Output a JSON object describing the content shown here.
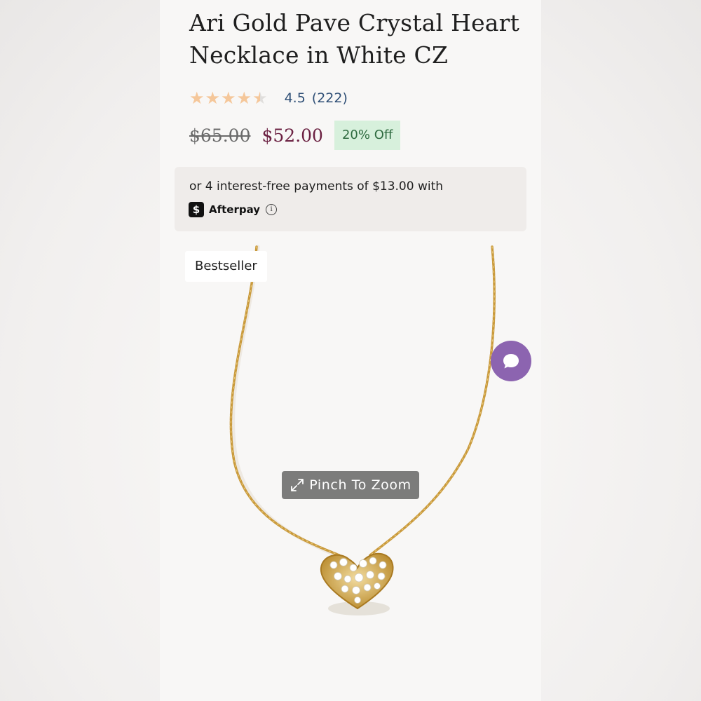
{
  "product": {
    "title": "Ari Gold Pave Crystal Heart Necklace in White CZ",
    "rating": {
      "value": "4.5",
      "count": "(222)",
      "stars_value": 4.5,
      "stars_max": 5
    },
    "price": {
      "original": "$65.00",
      "sale": "$52.00",
      "discount": "20% Off"
    },
    "afterpay": {
      "text": "or 4 interest-free payments of $13.00 with",
      "brand": "Afterpay",
      "logo_glyph": "$"
    },
    "image": {
      "badge": "Bestseller",
      "zoom_hint": "Pinch To Zoom"
    }
  },
  "colors": {
    "sale_price": "#6b2142",
    "rating_text": "#2f4f76",
    "star": "#f5c79a",
    "discount_bg": "#d7f0dc",
    "chat_button": "#8c64b0",
    "gold": "#c99a3d"
  },
  "icons": {
    "star": "star-icon",
    "info": "info-icon",
    "zoom": "expand-arrows-icon",
    "chat": "chat-bubble-icon"
  }
}
